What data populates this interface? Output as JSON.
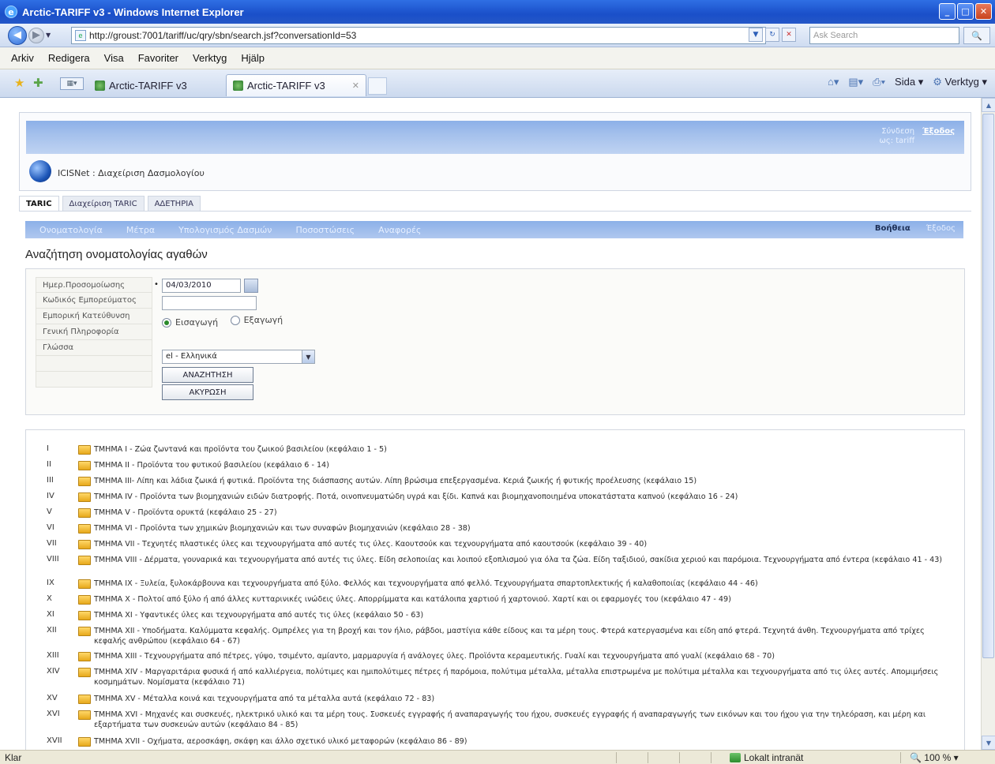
{
  "window": {
    "title": "Arctic-TARIFF v3 - Windows Internet Explorer"
  },
  "address": {
    "url": "http://groust:7001/tariff/uc/qry/sbn/search.jsf?conversationId=53",
    "search_placeholder": "Ask Search"
  },
  "menubar": [
    "Arkiv",
    "Redigera",
    "Visa",
    "Favoriter",
    "Verktyg",
    "Hjälp"
  ],
  "browser_tabs": [
    {
      "label": "Arctic-TARIFF v3"
    },
    {
      "label": "Arctic-TARIFF v3"
    }
  ],
  "command_bar": {
    "page": "Sida",
    "tools": "Verktyg"
  },
  "app": {
    "name": "ICISNet : Διαχείριση Δασμολογίου",
    "header_user": "Σύνδεση ως: tariff",
    "header_exit": "Έξοδος",
    "tabs": [
      "TARIC",
      "Διαχείριση TARIC",
      "ΑΔΕΤΗΡΙΑ"
    ],
    "menu": [
      "Ονοματολογία",
      "Μέτρα",
      "Υπολογισμός Δασμών",
      "Ποσοστώσεις",
      "Αναφορές"
    ],
    "help": "Βοήθεια",
    "logout": "Έξοδος"
  },
  "page": {
    "title": "Αναζήτηση ονοματολογίας αγαθών"
  },
  "form": {
    "labels": [
      "Ημερ.Προσομοίωσης",
      "Κωδικός Εμπορεύματος",
      "Εμπορική Κατεύθυνση",
      "Γενική Πληροφορία",
      "Γλώσσα"
    ],
    "date_value": "04/03/2010",
    "commodity_value": "",
    "direction_options": [
      "Εισαγωγή",
      "Εξαγωγή"
    ],
    "direction_selected": "Εισαγωγή",
    "language_value": "el - Ελληνικά",
    "search_button": "ΑΝΑΖΗΤΗΣΗ",
    "cancel_button": "ΑΚΥΡΩΣΗ"
  },
  "sections": [
    {
      "num": "I",
      "text": "ΤΜΗΜΑ I - Ζώα ζωντανά και προϊόντα του ζωικού βασιλείου (κεφάλαιο 1 - 5)"
    },
    {
      "num": "II",
      "text": "ΤΜΗΜΑ II - Προϊόντα του φυτικού βασιλείου (κεφάλαιο 6 - 14)"
    },
    {
      "num": "III",
      "text": "ΤΜΗΜΑ III- Λίπη και λάδια ζωικά ή φυτικά. Προϊόντα της διάσπασης αυτών. Λίπη βρώσιμα επεξεργασμένα. Κεριά ζωικής ή φυτικής προέλευσης (κεφάλαιο 15)"
    },
    {
      "num": "IV",
      "text": "ΤΜΗΜΑ IV - Προϊόντα των βιομηχανιών ειδών διατροφής. Ποτά, οινοπνευματώδη υγρά και ξίδι. Καπνά και βιομηχανοποιημένα υποκατάστατα καπνού (κεφάλαιο 16 - 24)"
    },
    {
      "num": "V",
      "text": "ΤΜΗΜΑ V - Προϊόντα ορυκτά (κεφάλαιο 25 - 27)"
    },
    {
      "num": "VI",
      "text": "ΤΜΗΜΑ VI - Προϊόντα των χημικών βιομηχανιών και των συναφών βιομηχανιών (κεφάλαιο 28 - 38)"
    },
    {
      "num": "VII",
      "text": "ΤΜΗΜΑ VII - Τεχνητές πλαστικές ύλες και τεχνουργήματα από αυτές τις ύλες. Καουτσούκ και τεχνουργήματα από καουτσούκ (κεφάλαιο 39 - 40)"
    },
    {
      "num": "VIII",
      "text": "ΤΜΗΜΑ VIII - Δέρματα, γουναρικά και τεχνουργήματα από αυτές τις ύλες. Είδη σελοποιίας και λοιπού εξοπλισμού για όλα τα ζώα. Είδη ταξιδιού, σακίδια χεριού και παρόμοια. Τεχνουργήματα από έντερα (κεφάλαιο 41 - 43)"
    },
    {
      "num": "IX",
      "text": "ΤΜΗΜΑ IX - Ξυλεία, ξυλοκάρβουνα και τεχνουργήματα από ξύλο. Φελλός και τεχνουργήματα από φελλό. Τεχνουργήματα σπαρτοπλεκτικής ή καλαθοποιίας (κεφάλαιο 44 - 46)"
    },
    {
      "num": "X",
      "text": "ΤΜΗΜΑ X - Πολτοί από ξύλο ή από άλλες κυτταρινικές ινώδεις ύλες. Απορρίμματα και κατάλοιπα χαρτιού ή χαρτονιού. Χαρτί και οι εφαρμογές του (κεφάλαιο 47 - 49)"
    },
    {
      "num": "XI",
      "text": "ΤΜΗΜΑ XI - Υφαντικές ύλες και τεχνουργήματα από αυτές τις ύλες (κεφάλαιο 50 - 63)"
    },
    {
      "num": "XII",
      "text": "ΤΜΗΜΑ XII - Υποδήματα. Καλύμματα κεφαλής. Ομπρέλες για τη βροχή και τον ήλιο, ράβδοι, μαστίγια κάθε είδους και τα μέρη τους. Φτερά κατεργασμένα και είδη από φτερά. Τεχνητά άνθη. Τεχνουργήματα από τρίχες κεφαλής ανθρώπου (κεφάλαιο 64 - 67)"
    },
    {
      "num": "XIII",
      "text": "ΤΜΗΜΑ XIII - Τεχνουργήματα από πέτρες, γύψο, τσιμέντο, αμίαντο, μαρμαρυγία ή ανάλογες ύλες. Προϊόντα κεραμευτικής. Γυαλί και τεχνουργήματα από γυαλί (κεφάλαιο 68 - 70)"
    },
    {
      "num": "XIV",
      "text": "ΤΜΗΜΑ XIV - Μαργαριτάρια φυσικά ή από καλλιέργεια, πολύτιμες και ημιπολύτιμες πέτρες ή παρόμοια, πολύτιμα μέταλλα, μέταλλα επιστρωμένα με πολύτιμα μέταλλα και τεχνουργήματα από τις ύλες αυτές. Απομιμήσεις κοσμημάτων. Νομίσματα (κεφάλαιο 71)"
    },
    {
      "num": "XV",
      "text": "ΤΜΗΜΑ XV - Μέταλλα κοινά και τεχνουργήματα από τα μέταλλα αυτά (κεφάλαιο 72 - 83)"
    },
    {
      "num": "XVI",
      "text": "ΤΜΗΜΑ XVI - Μηχανές και συσκευές, ηλεκτρικό υλικό και τα μέρη τους. Συσκευές εγγραφής ή αναπαραγωγής του ήχου, συσκευές εγγραφής ή αναπαραγωγής των εικόνων και του ήχου για την τηλεόραση, και μέρη και εξαρτήματα των συσκευών αυτών (κεφάλαιο 84 - 85)"
    },
    {
      "num": "XVII",
      "text": "ΤΜΗΜΑ XVII - Οχήματα, αεροσκάφη, σκάφη και άλλο σχετικό υλικό μεταφορών (κεφάλαιο 86 - 89)"
    }
  ],
  "status": {
    "left": "Klar",
    "zone": "Lokalt intranät",
    "zoom": "100 %"
  }
}
